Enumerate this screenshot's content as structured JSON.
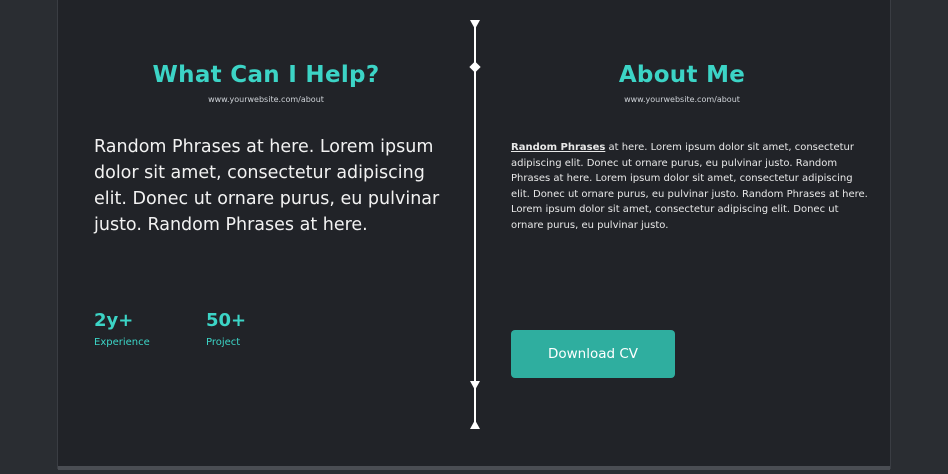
{
  "left": {
    "heading": "What Can I Help?",
    "url": "www.yourwebsite.com/about",
    "body": "Random Phrases at here. Lorem ipsum dolor sit amet, consectetur adipiscing elit. Donec ut ornare purus, eu pulvinar justo. Random Phrases at here.",
    "stats": [
      {
        "value": "2y+",
        "label": "Experience"
      },
      {
        "value": "50+",
        "label": "Project"
      }
    ]
  },
  "right": {
    "heading": "About Me",
    "url": "www.yourwebsite.com/about",
    "body_bold": "Random Phrases",
    "body_rest": " at here. Lorem ipsum dolor sit amet, consectetur adipiscing elit. Donec ut ornare purus, eu pulvinar justo. Random Phrases at here. Lorem ipsum dolor sit amet, consectetur adipiscing elit. Donec ut ornare purus, eu pulvinar justo. Random Phrases at here. Lorem ipsum dolor sit amet, consectetur adipiscing elit. Donec ut ornare purus, eu pulvinar justo.",
    "button_label": "Download CV"
  },
  "colors": {
    "accent": "#3cd4c6",
    "button": "#2fae9f",
    "background": "#212328"
  }
}
